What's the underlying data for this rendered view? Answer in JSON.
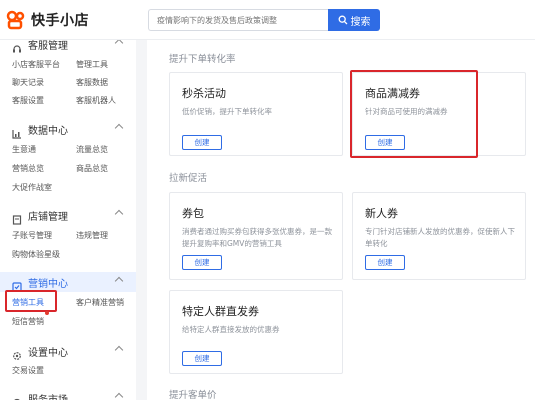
{
  "header": {
    "logo_text": "快手小店",
    "search_placeholder": "疫情影响下的发货及售后政策调整",
    "search_button": "搜索"
  },
  "sidebar": {
    "customer_service": {
      "title": "客服管理",
      "items": [
        "小店客服平台",
        "管理工具",
        "聊天记录",
        "客服数据",
        "客服设置",
        "客服机器人"
      ]
    },
    "data_center": {
      "title": "数据中心",
      "items": [
        "生意通",
        "流量总览",
        "营销总览",
        "商品总览",
        "大促作战室"
      ]
    },
    "store_management": {
      "title": "店铺管理",
      "items": [
        "子账号管理",
        "违规管理",
        "购物体验星级"
      ]
    },
    "marketing_center": {
      "title": "营销中心",
      "items": [
        "营销工具",
        "客户精准营销",
        "短信营销"
      ]
    },
    "settings_center": {
      "title": "设置中心",
      "items": [
        "交易设置"
      ]
    },
    "service_market": {
      "title": "服务市场"
    }
  },
  "main": {
    "groups": [
      {
        "title": "提升下单转化率",
        "cards": [
          {
            "title": "秒杀活动",
            "desc": "低价促销，提升下单转化率",
            "button": "创建"
          },
          {
            "title": "商品满减券",
            "desc": "针对商品可使用的满减券",
            "button": "创建"
          }
        ]
      },
      {
        "title": "拉新促活",
        "cards": [
          {
            "title": "券包",
            "desc": "消费者通过购买券包获得多张优惠券，是一款提升复购率和GMV的营销工具",
            "button": "创建"
          },
          {
            "title": "新人券",
            "desc": "专门针对店铺新人发放的优惠券，促使新人下单转化",
            "button": "创建"
          },
          {
            "title": "特定人群直发券",
            "desc": "给特定人群直接发放的优惠券",
            "button": "创建"
          }
        ]
      },
      {
        "title": "提升客单价"
      }
    ]
  },
  "colors": {
    "accent": "#2f6ce5",
    "highlight": "#d9262b",
    "brand": "#ff5000"
  }
}
